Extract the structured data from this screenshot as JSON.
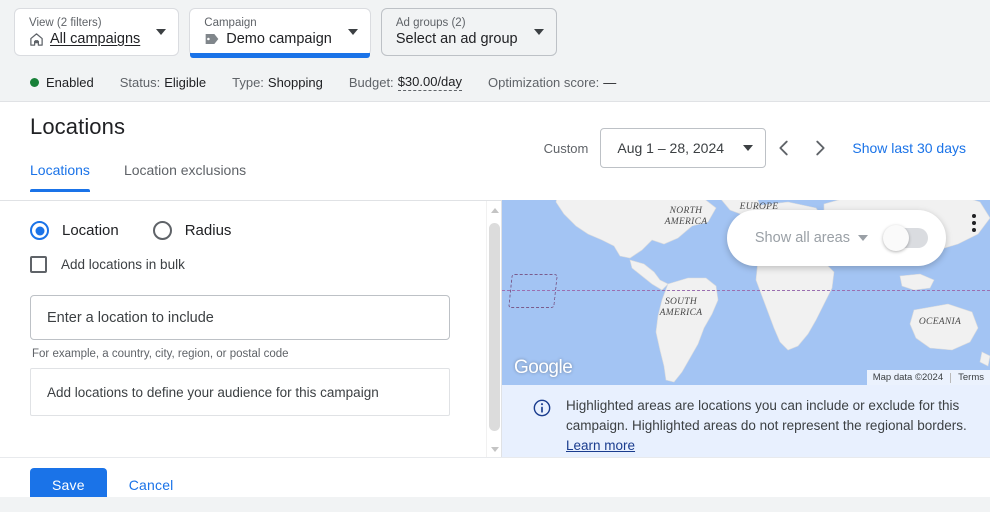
{
  "selectors": [
    {
      "label": "View (2 filters)",
      "value": "All campaigns",
      "icon": "home-icon",
      "underlined": true,
      "active": false
    },
    {
      "label": "Campaign",
      "value": "Demo campaign",
      "icon": "tag-icon",
      "underlined": false,
      "active": true
    },
    {
      "label": "Ad groups (2)",
      "value": "Select an ad group",
      "icon": "none",
      "underlined": false,
      "active": false
    }
  ],
  "status_strip": {
    "state": "Enabled",
    "state_color": "#188038",
    "status_key": "Status:",
    "status_value": "Eligible",
    "type_key": "Type:",
    "type_value": "Shopping",
    "budget_key": "Budget:",
    "budget_value": "$30.00/day",
    "opt_key": "Optimization score:",
    "opt_value": "—"
  },
  "header": {
    "title": "Locations"
  },
  "daterange": {
    "custom_label": "Custom",
    "value": "Aug 1 – 28, 2024",
    "prev_label": "‹",
    "next_label": "›",
    "show_last": "Show last 30 days"
  },
  "tabs": [
    {
      "label": "Locations",
      "active": true
    },
    {
      "label": "Location exclusions",
      "active": false
    }
  ],
  "form": {
    "radios": [
      {
        "label": "Location",
        "checked": true
      },
      {
        "label": "Radius",
        "checked": false
      }
    ],
    "bulk_checkbox": {
      "label": "Add locations in bulk",
      "checked": false
    },
    "location_input": {
      "value": "",
      "placeholder": "Enter a location to include"
    },
    "helper_text": "For example, a country, city, region, or postal code",
    "empty_state": "Add locations to define your audience for this campaign"
  },
  "map": {
    "areas_control": {
      "label": "Show all areas",
      "toggle_on": false
    },
    "labels": [
      {
        "text": "NORTH\nAMERICA"
      },
      {
        "text": "SOUTH\nAMERICA"
      },
      {
        "text": "EUROPE"
      },
      {
        "text": "OCEANIA"
      }
    ],
    "watermark": "Google",
    "attribution": "Map data ©2024",
    "terms": "Terms",
    "menu_icon": "kebab-menu-icon"
  },
  "info_banner": {
    "icon": "info-icon",
    "text": "Highlighted areas are locations you can include or exclude for this campaign. Highlighted areas do not represent the regional borders. ",
    "link": "Learn more"
  },
  "actions": {
    "save_label": "Save",
    "cancel_label": "Cancel"
  },
  "colors": {
    "accent": "#1a73e8",
    "enabled": "#188038",
    "info_bg": "#e8f0fe",
    "map_water": "#a3c4f3",
    "page_bg": "#f1f3f4"
  }
}
